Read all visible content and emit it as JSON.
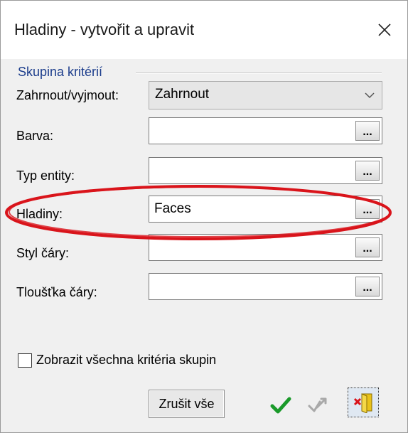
{
  "window": {
    "title": "Hladiny - vytvořit a upravit",
    "close_icon": "close-icon"
  },
  "group": {
    "title": "Skupina kritérií"
  },
  "include_exclude": {
    "label": "Zahrnout/vyjmout:",
    "value": "Zahrnout",
    "icon": "chevron-down-icon"
  },
  "fields": [
    {
      "label": "Barva:",
      "value": "",
      "button": "..."
    },
    {
      "label": "Typ entity:",
      "value": "",
      "button": "..."
    },
    {
      "label": "Hladiny:",
      "value": "Faces",
      "button": "..."
    },
    {
      "label": "Styl čáry:",
      "value": "",
      "button": "..."
    },
    {
      "label": "Tloušťka čáry:",
      "value": "",
      "button": "..."
    }
  ],
  "annotation": {
    "highlight_color": "#d9141b"
  },
  "show_all": {
    "label": "Zobrazit všechna kritéria skupin",
    "checked": false
  },
  "buttons": {
    "clear_all": "Zrušit vše",
    "ok_icon": "checkmark-icon",
    "apply_icon": "apply-icon",
    "exit_icon": "exit-icon"
  },
  "colors": {
    "group_title": "#1c3d8c",
    "checkmark": "#1a9a2a",
    "exit_icon_yellow": "#e9c21a"
  }
}
